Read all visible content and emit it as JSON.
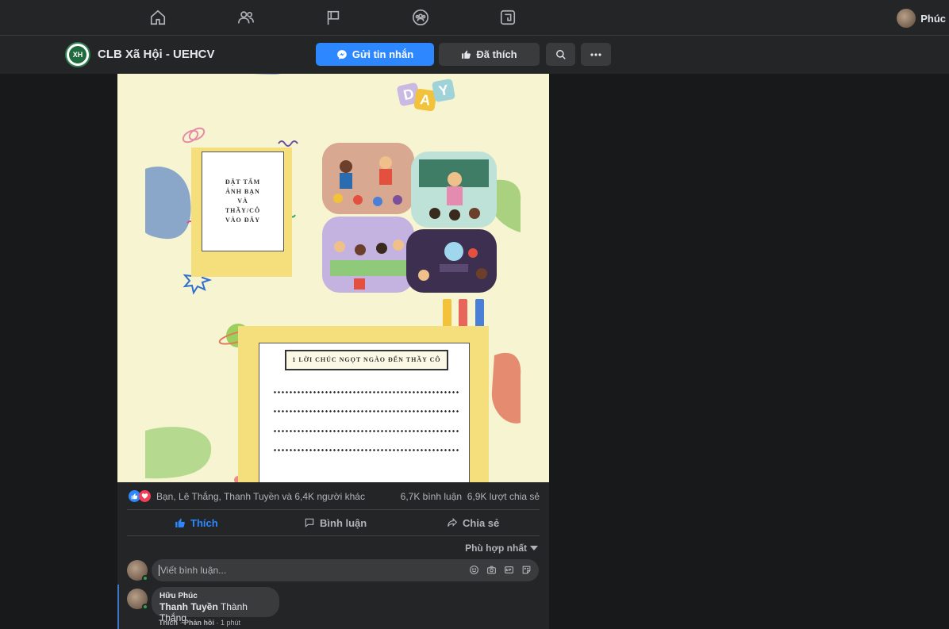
{
  "topnav": {
    "icons": [
      "home-icon",
      "friends-icon",
      "pages-flag-icon",
      "groups-icon",
      "gaming-icon"
    ],
    "profile_name": "Phúc"
  },
  "page": {
    "logo_text": "XH",
    "name": "CLB Xã Hội - UEHCV",
    "message_button": "Gửi tin nhắn",
    "liked_button": "Đã thích"
  },
  "poster": {
    "day_letters": [
      "D",
      "A",
      "Y"
    ],
    "photo_frame_text": [
      "ĐẶT TẤM",
      "ẢNH BẠN",
      "VÀ",
      "THẦY/CÔ",
      "VÀO ĐÂY"
    ],
    "wish_title": "1 LỜI CHÚC NGỌT NGÀO ĐẾN THẦY CÔ"
  },
  "post": {
    "reactions_who": "Bạn, Lê Thắng, Thanh Tuyền và 6,4K người khác",
    "comments_count": "6,7K bình luận",
    "shares_count": "6,9K lượt chia sẻ",
    "actions": {
      "like": "Thích",
      "comment": "Bình luận",
      "share": "Chia sẻ"
    },
    "sort_label": "Phù hợp nhất",
    "composer_placeholder": "Viết bình luận..."
  },
  "comment": {
    "author": "Hữu Phúc",
    "mention": "Thanh Tuyền",
    "text": " Thành Thắng",
    "like": "Thích",
    "reply": "Phản hồi",
    "time": "1 phút"
  },
  "colors": {
    "accent": "#2d88ff",
    "background": "#18191a",
    "surface": "#242526",
    "poster_bg": "#f7f4d1"
  }
}
